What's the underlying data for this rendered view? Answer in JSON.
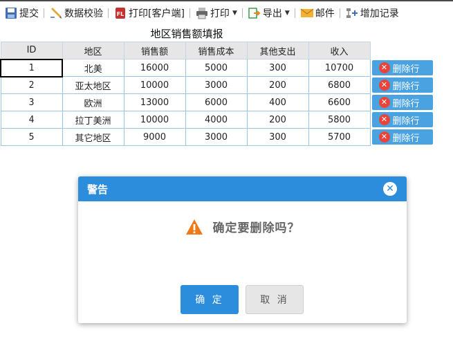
{
  "toolbar": {
    "submit": "提交",
    "validate": "数据校验",
    "print_client": "打印[客户端]",
    "print": "打印",
    "export": "导出",
    "mail": "邮件",
    "add_record": "增加记录"
  },
  "report": {
    "title": "地区销售额填报",
    "columns": [
      "ID",
      "地区",
      "销售额",
      "销售成本",
      "其他支出",
      "收入"
    ],
    "rows": [
      {
        "id": "1",
        "region": "北美",
        "sales": "16000",
        "cost": "5000",
        "other": "300",
        "income": "10700"
      },
      {
        "id": "2",
        "region": "亚太地区",
        "sales": "10000",
        "cost": "3000",
        "other": "200",
        "income": "6800"
      },
      {
        "id": "3",
        "region": "欧洲",
        "sales": "13000",
        "cost": "6000",
        "other": "400",
        "income": "6600"
      },
      {
        "id": "4",
        "region": "拉丁美洲",
        "sales": "10000",
        "cost": "4000",
        "other": "200",
        "income": "5800"
      },
      {
        "id": "5",
        "region": "其它地区",
        "sales": "9000",
        "cost": "3000",
        "other": "300",
        "income": "5700"
      }
    ],
    "delete_label": "删除行"
  },
  "dialog": {
    "title": "警告",
    "message": "确定要删除吗？",
    "ok_label": "确 定",
    "cancel_label": "取 消"
  },
  "colors": {
    "accent": "#2b8ddc",
    "delete_button": "#4aa3e0",
    "danger": "#e8443a",
    "warning": "#f07a1a"
  }
}
